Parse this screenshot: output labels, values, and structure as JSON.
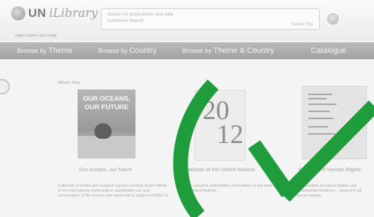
{
  "header": {
    "logo_un": "UN",
    "logo_library": "iLibrary",
    "search_placeholder_1": "Search for publications and data",
    "search_placeholder_2": "Advanced Search",
    "search_tips": "Search Tips",
    "breadcrumb": "Help | Home | Go | Help"
  },
  "nav": {
    "items": [
      {
        "prefix": "Browse by",
        "label": "Theme"
      },
      {
        "prefix": "Browse by",
        "label": "Country"
      },
      {
        "prefix": "Browse by",
        "label": "Theme & Country"
      }
    ],
    "catalogue": "Catalogue"
  },
  "content": {
    "section_label": "What's New",
    "books": [
      {
        "cover_text": "OUR OCEANS, OUR FUTURE",
        "title": "Our oceans, our future",
        "description": "Collection of books and research reports covering recent efforts of the international community in sustainable use and conservation of the oceans and marine life in support of SDG 14."
      },
      {
        "cover_text_1": "20",
        "cover_text_2": "12",
        "title": "Yearbook of the United Nations",
        "description": "...provides authoritative information on the work of the United Nations."
      },
      {
        "title": "Yearbook of Human Rights",
        "description": "...declaration of Human Rights and fundamental freedoms... respect to all human beings."
      }
    ]
  },
  "colors": {
    "check_green": "#1f9d3c",
    "nav_gray": "#ababab"
  },
  "icons": [
    "globe-logo-icon",
    "search-icon",
    "checkmark-icon"
  ]
}
